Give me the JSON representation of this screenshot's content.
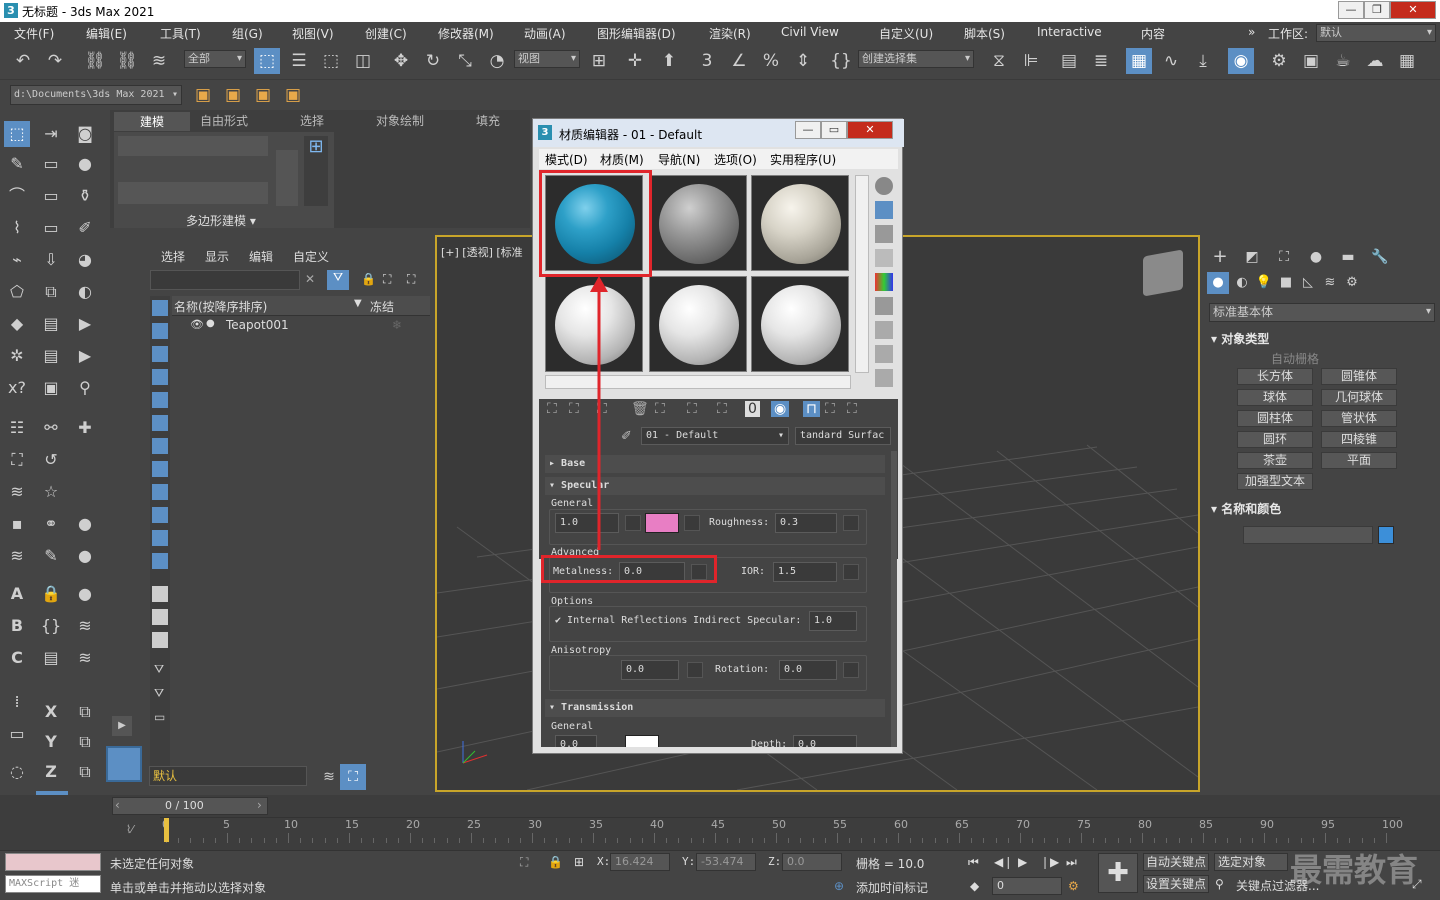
{
  "window": {
    "title": "无标题 - 3ds Max 2021",
    "logo": "3"
  },
  "menubar": {
    "items": [
      "文件(F)",
      "编辑(E)",
      "工具(T)",
      "组(G)",
      "视图(V)",
      "创建(C)",
      "修改器(M)",
      "动画(A)",
      "图形编辑器(D)",
      "渲染(R)",
      "Civil View",
      "自定义(U)",
      "脚本(S)",
      "Interactive",
      "内容"
    ],
    "workspace_label": "工作区:",
    "workspace_value": "默认"
  },
  "toolbar": {
    "filter_value": "全部",
    "refcoord_value": "视图",
    "selset_value": "创建选择集",
    "path_value": "d:\\Documents\\3ds Max 2021"
  },
  "ribbon": {
    "tabs": [
      "建模",
      "自由形式",
      "选择",
      "对象绘制",
      "填充"
    ],
    "group_label": "多边形建模 ▾"
  },
  "scene_explorer": {
    "tabs": [
      "选择",
      "显示",
      "编辑",
      "自定义"
    ],
    "col_name": "名称(按降序排序)",
    "col_frozen": "冻结",
    "item": "Teapot001",
    "layer_value": "默认"
  },
  "viewport": {
    "label": "[+] [透视] [标准"
  },
  "command_panel": {
    "dropdown": "标准基本体",
    "object_type_title": "对象类型",
    "autogrid": "自动栅格",
    "buttons": [
      "长方体",
      "圆锥体",
      "球体",
      "几何球体",
      "圆柱体",
      "管状体",
      "圆环",
      "四棱锥",
      "茶壶",
      "平面",
      "加强型文本"
    ],
    "name_color_title": "名称和颜色",
    "object_color": "#3c8fd9"
  },
  "material_editor": {
    "title": "材质编辑器 - 01 - Default",
    "menu": [
      "模式(D)",
      "材质(M)",
      "导航(N)",
      "选项(O)",
      "实用程序(U)"
    ],
    "material_name": "01 - Default",
    "material_type": "tandard Surfac",
    "sections": {
      "base": "Base",
      "specular": "Specular",
      "transmission": "Transmission"
    },
    "general_label": "General",
    "specular_weight": "1.0",
    "specular_color": "#e87ec4",
    "roughness_label": "Roughness:",
    "roughness_value": "0.3",
    "advanced_label": "Advanced",
    "metalness_label": "Metalness:",
    "metalness_value": "0.0",
    "ior_label": "IOR:",
    "ior_value": "1.5",
    "options_label": "Options",
    "internal_refl_label": "Internal Reflections",
    "indirect_spec_label": "Indirect Specular:",
    "indirect_spec_value": "1.0",
    "anisotropy_label": "Anisotropy",
    "anisotropy_value": "0.0",
    "rotation_label": "Rotation:",
    "rotation_value": "0.0",
    "trans_general_label": "General",
    "trans_weight": "0.0",
    "depth_label": "Depth:",
    "depth_value": "0.0"
  },
  "timeline": {
    "frame_counter": "0 / 100",
    "ticks": [
      "0",
      "5",
      "10",
      "15",
      "20",
      "25",
      "30",
      "35",
      "40",
      "45",
      "50",
      "55",
      "60",
      "65",
      "70",
      "75",
      "80",
      "85",
      "90",
      "95",
      "100"
    ]
  },
  "status": {
    "maxscript": "MAXScript 迷",
    "msg1": "未选定任何对象",
    "msg2": "单击或单击并拖动以选择对象",
    "x_label": "X:",
    "x_value": "16.424",
    "y_label": "Y:",
    "y_value": "-53.474",
    "z_label": "Z:",
    "z_value": "0.0",
    "grid": "栅格 = 10.0",
    "add_time_tag": "添加时间标记",
    "autokey": "自动关键点",
    "selected_object": "选定对象",
    "setkey": "设置关键点",
    "key_filter": "关键点过滤器...",
    "frame_value": "0",
    "watermark": "最需教育"
  }
}
